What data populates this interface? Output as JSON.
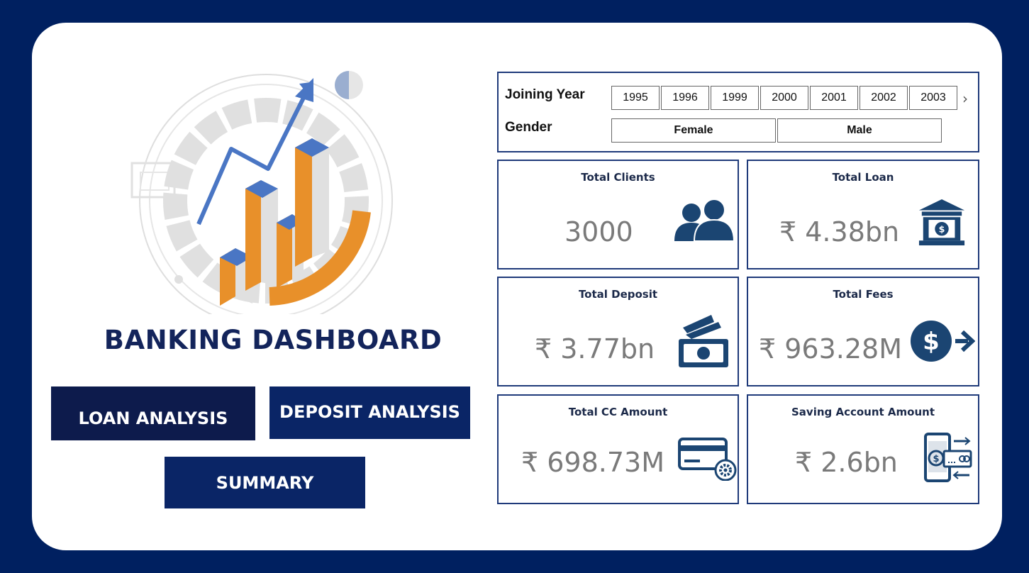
{
  "dashboard": {
    "title": "BANKING DASHBOARD"
  },
  "nav": {
    "loan_label": "LOAN ANALYSIS",
    "deposit_label": "DEPOSIT ANALYSIS",
    "summary_label": "SUMMARY"
  },
  "filters": {
    "year_label": "Joining Year",
    "years": [
      "1995",
      "1996",
      "1999",
      "2000",
      "2001",
      "2002",
      "2003"
    ],
    "gender_label": "Gender",
    "genders": [
      "Female",
      "Male"
    ]
  },
  "kpis": {
    "clients": {
      "title": "Total Clients",
      "value": "3000",
      "icon": "people-icon"
    },
    "loan": {
      "title": "Total Loan",
      "value": "₹ 4.38bn",
      "icon": "bank-icon"
    },
    "deposit": {
      "title": "Total Deposit",
      "value": "₹ 3.77bn",
      "icon": "cash-icon"
    },
    "fees": {
      "title": "Total Fees",
      "value": "₹ 963.28M",
      "icon": "dollar-arrow-icon"
    },
    "cc": {
      "title": "Total CC Amount",
      "value": "₹ 698.73M",
      "icon": "credit-card-icon"
    },
    "saving": {
      "title": "Saving Account Amount",
      "value": "₹ 2.6bn",
      "icon": "mobile-payment-icon"
    }
  },
  "colors": {
    "background": "#002060",
    "accent_dark": "#0d1b4c",
    "button": "#0a2566",
    "icon": "#1b4572",
    "bar_orange": "#e8902a",
    "arrow_blue": "#4a76c4"
  }
}
